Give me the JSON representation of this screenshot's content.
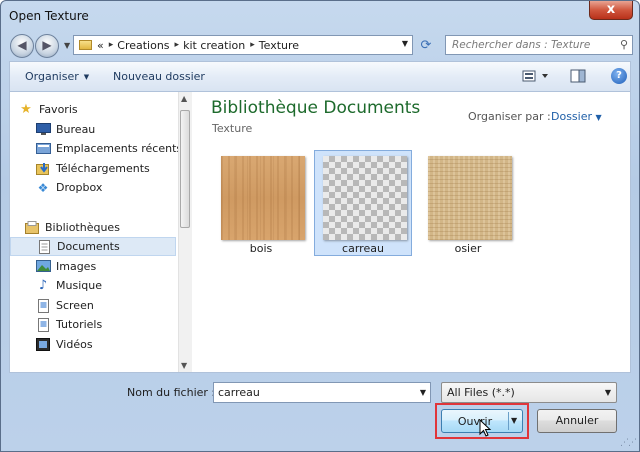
{
  "window": {
    "title": "Open Texture",
    "close_label": "x"
  },
  "nav": {
    "back_glyph": "◀",
    "forward_glyph": "▶",
    "address_prefix": "«",
    "breadcrumbs": [
      "Creations",
      "kit creation",
      "Texture"
    ],
    "search_placeholder": "Rechercher dans : Texture"
  },
  "toolbar": {
    "organize_label": "Organiser",
    "new_folder_label": "Nouveau dossier",
    "help_label": "?"
  },
  "sidebar": {
    "favorites": {
      "header": "Favoris",
      "items": [
        "Bureau",
        "Emplacements récents",
        "Téléchargements",
        "Dropbox"
      ]
    },
    "libraries": {
      "header": "Bibliothèques",
      "items": [
        "Documents",
        "Images",
        "Musique",
        "Screen",
        "Tutoriels",
        "Vidéos"
      ],
      "selected": "Documents"
    }
  },
  "main": {
    "library_title": "Bibliothèque Documents",
    "library_subtitle": "Texture",
    "arrange_label": "Organiser par :",
    "arrange_value": "Dossier",
    "files": [
      {
        "name": "bois",
        "texture": "wood",
        "selected": false
      },
      {
        "name": "carreau",
        "texture": "transparent-checker",
        "selected": true
      },
      {
        "name": "osier",
        "texture": "wicker",
        "selected": false
      }
    ]
  },
  "bottom": {
    "filename_label": "Nom du fichier :",
    "filename_value": "carreau",
    "filetype_value": "All Files (*.*)",
    "open_label": "Ouvrir",
    "cancel_label": "Annuler"
  },
  "colors": {
    "library_title": "#1d6a2c",
    "selection": "#cfe3fb",
    "highlight_box": "#e0353a",
    "close_button": "#c94a33"
  }
}
